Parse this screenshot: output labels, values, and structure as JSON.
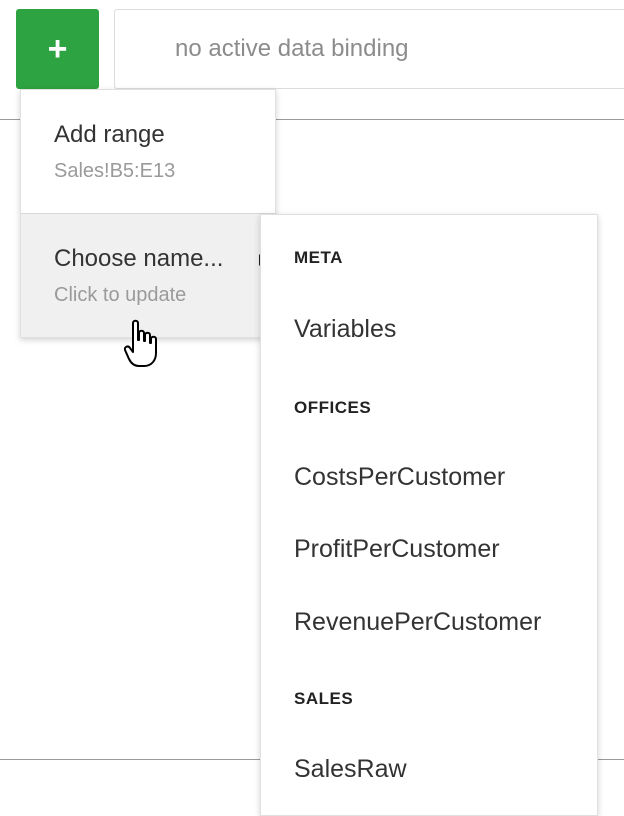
{
  "toolbar": {
    "add_button_label": "+",
    "binding_field_text": "no active data binding"
  },
  "menu": {
    "items": [
      {
        "title": "Add range",
        "subtitle": "Sales!B5:E13"
      },
      {
        "title": "Choose name...",
        "subtitle": "Click to update"
      }
    ]
  },
  "submenu": {
    "groups": [
      {
        "header": "META",
        "items": [
          "Variables"
        ]
      },
      {
        "header": "OFFICES",
        "items": [
          "CostsPerCustomer",
          "ProfitPerCustomer",
          "RevenuePerCustomer"
        ]
      },
      {
        "header": "SALES",
        "items": [
          "SalesRaw"
        ]
      }
    ]
  },
  "colors": {
    "accent_green": "#2ea341",
    "highlight_bg": "#f0f0f0",
    "muted_text": "#9a9a9a"
  },
  "icons": {
    "add": "plus-icon",
    "submenu": "submenu-arrow-icon",
    "cursor": "hand-pointer-icon"
  }
}
